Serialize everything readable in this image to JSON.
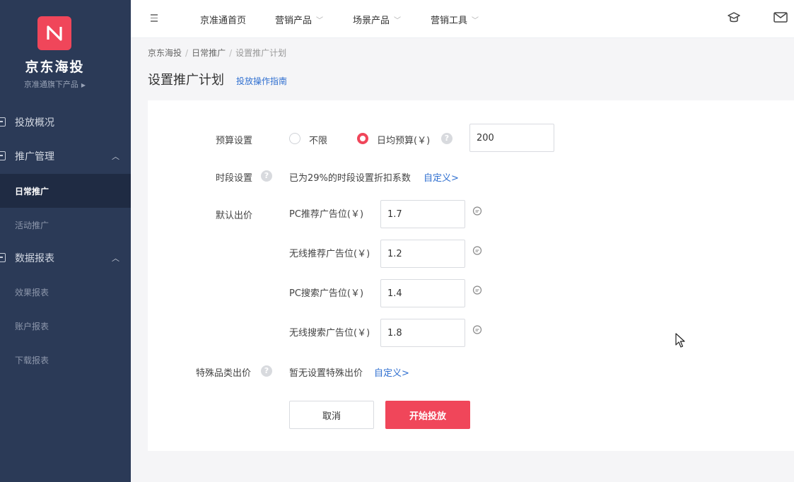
{
  "sidebar": {
    "brand_title": "京东海投",
    "brand_sub": "京准通旗下产品",
    "groups": [
      {
        "label": "投放概况"
      },
      {
        "label": "推广管理",
        "items": [
          "日常推广",
          "活动推广"
        ]
      },
      {
        "label": "数据报表",
        "items": [
          "效果报表",
          "账户报表",
          "下载报表"
        ]
      }
    ]
  },
  "topbar": {
    "nav": [
      "京准通首页",
      "营销产品",
      "场景产品",
      "营销工具"
    ]
  },
  "breadcrumb": [
    "京东海投",
    "日常推广",
    "设置推广计划"
  ],
  "page": {
    "title": "设置推广计划",
    "guide_link": "投放操作指南"
  },
  "form": {
    "budget": {
      "label": "预算设置",
      "option_unlimited": "不限",
      "option_daily": "日均预算(￥)",
      "selected": "日均预算(￥)",
      "value": "200"
    },
    "schedule": {
      "label": "时段设置",
      "text": "已为29%的时段设置折扣系数",
      "link": "自定义>"
    },
    "default_bid": {
      "label": "默认出价",
      "rows": [
        {
          "label": "PC推荐广告位(￥)",
          "value": "1.7"
        },
        {
          "label": "无线推荐广告位(￥)",
          "value": "1.2"
        },
        {
          "label": "PC搜索广告位(￥)",
          "value": "1.4"
        },
        {
          "label": "无线搜索广告位(￥)",
          "value": "1.8"
        }
      ]
    },
    "special": {
      "label": "特殊品类出价",
      "text": "暂无设置特殊出价",
      "link": "自定义>"
    },
    "cancel_label": "取消",
    "submit_label": "开始投放"
  },
  "colors": {
    "sidebar_bg": "#2b3a57",
    "accent": "#f0465a",
    "link": "#2f6fd0"
  }
}
